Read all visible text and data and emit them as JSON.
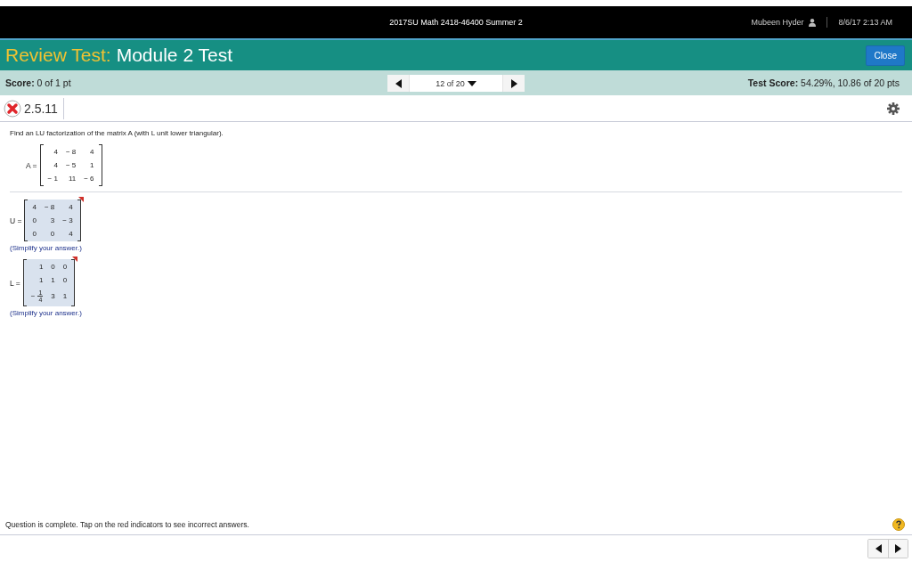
{
  "top_bar": {
    "course": "2017SU Math 2418-46400 Summer 2",
    "user": "Mubeen Hyder",
    "datetime": "8/6/17 2:13 AM"
  },
  "title_bar": {
    "prefix": "Review Test:",
    "title": "Module 2 Test",
    "close_button": "Close"
  },
  "score_bar": {
    "score_label": "Score:",
    "score": "0 of 1 pt",
    "pager": "12 of 20",
    "test_score_label": "Test Score:",
    "test_score": "54.29%, 10.86 of 20 pts"
  },
  "question": {
    "number": "2.5.11",
    "correct": false,
    "prompt": "Find an LU factorization of the matrix A (with L unit lower triangular).",
    "given": {
      "label": "A =",
      "rows": [
        [
          {
            "kind": "text",
            "text": "4"
          },
          {
            "kind": "text",
            "text": "− 8"
          },
          {
            "kind": "text",
            "text": "4"
          }
        ],
        [
          {
            "kind": "text",
            "text": "4"
          },
          {
            "kind": "text",
            "text": "− 5"
          },
          {
            "kind": "text",
            "text": "1"
          }
        ],
        [
          {
            "kind": "text",
            "text": "− 1"
          },
          {
            "kind": "text",
            "text": "11"
          },
          {
            "kind": "text",
            "text": "− 6"
          }
        ]
      ]
    },
    "answers": [
      {
        "label": "U =",
        "incorrect": true,
        "hint": "(Simplify your answer.)",
        "rows": [
          [
            {
              "kind": "text",
              "text": "4"
            },
            {
              "kind": "text",
              "text": "− 8"
            },
            {
              "kind": "text",
              "text": "4"
            }
          ],
          [
            {
              "kind": "text",
              "text": "0"
            },
            {
              "kind": "text",
              "text": "3"
            },
            {
              "kind": "text",
              "text": "− 3"
            }
          ],
          [
            {
              "kind": "text",
              "text": "0"
            },
            {
              "kind": "text",
              "text": "0"
            },
            {
              "kind": "text",
              "text": "4"
            }
          ]
        ]
      },
      {
        "label": "L =",
        "incorrect": true,
        "hint": "(Simplify your answer.)",
        "rows": [
          [
            {
              "kind": "text",
              "text": "1"
            },
            {
              "kind": "text",
              "text": "0"
            },
            {
              "kind": "text",
              "text": "0"
            }
          ],
          [
            {
              "kind": "text",
              "text": "1"
            },
            {
              "kind": "text",
              "text": "1"
            },
            {
              "kind": "text",
              "text": "0"
            }
          ],
          [
            {
              "kind": "fraction",
              "sign": "−",
              "num": "1",
              "den": "4"
            },
            {
              "kind": "text",
              "text": "3"
            },
            {
              "kind": "text",
              "text": "1"
            }
          ]
        ]
      }
    ]
  },
  "footer": {
    "status": "Question is complete. Tap on the red indicators to see incorrect answers."
  }
}
